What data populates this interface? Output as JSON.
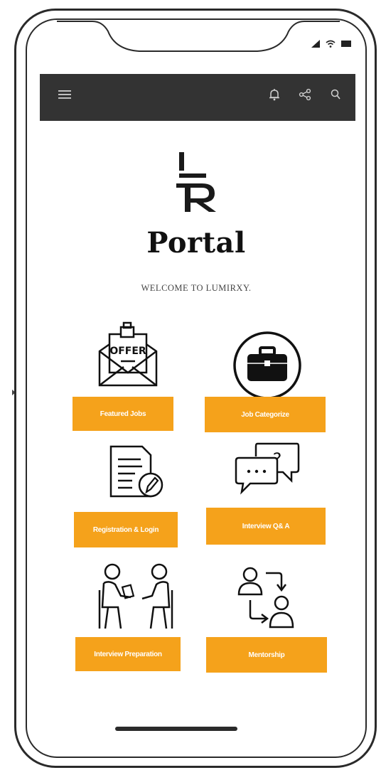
{
  "app": {
    "title": "Portal",
    "welcome": "WELCOME TO LUMIRXY.",
    "logo_letters": "LR"
  },
  "appbar": {
    "icons": [
      "menu-icon",
      "bell-icon",
      "share-icon",
      "search-icon"
    ]
  },
  "status_bar": {
    "icons": [
      "signal-icon",
      "wifi-icon",
      "battery-icon"
    ]
  },
  "tiles": [
    {
      "label": "Featured Jobs",
      "icon": "offer-envelope-icon",
      "icon_text": "OFFER"
    },
    {
      "label": "Job Categorize",
      "icon": "briefcase-icon"
    },
    {
      "label": "Registration & Login",
      "icon": "form-pencil-icon"
    },
    {
      "label": "Interview Q& A",
      "icon": "chat-question-icon",
      "icon_text": "?"
    },
    {
      "label": "Interview Preparation",
      "icon": "people-interview-icon"
    },
    {
      "label": "Mentorship",
      "icon": "mentorship-icon"
    }
  ],
  "colors": {
    "accent": "#F5A21B",
    "appbar": "#333333",
    "text": "#111111",
    "frame": "#2a2a2a"
  }
}
